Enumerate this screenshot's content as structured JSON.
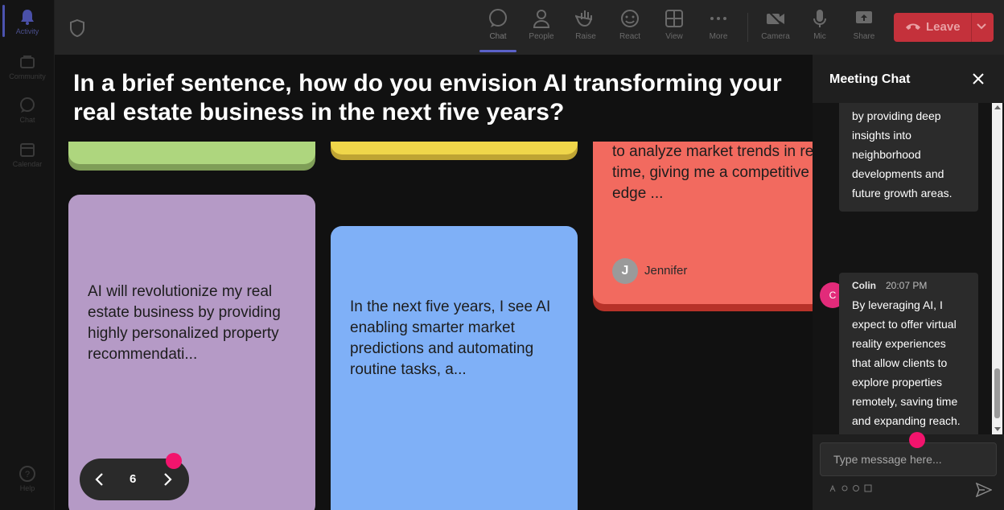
{
  "leftbar": {
    "items": [
      {
        "label": "Activity",
        "icon": "bell-icon"
      },
      {
        "label": "Community",
        "icon": "community-icon"
      },
      {
        "label": "Chat",
        "icon": "chat-icon"
      },
      {
        "label": "Calendar",
        "icon": "calendar-icon"
      },
      {
        "label": "Help",
        "icon": "help-icon"
      }
    ]
  },
  "toolbar": {
    "chat": "Chat",
    "people": "People",
    "raise": "Raise",
    "react": "React",
    "view": "View",
    "more": "More",
    "camera": "Camera",
    "mic": "Mic",
    "share": "Share",
    "leave": "Leave"
  },
  "stage": {
    "question": "In a brief sentence, how do you envision AI transforming your real estate business in the next five years?",
    "cards": [
      {
        "text": "AI will revolutionize my real estate business by providing highly personalized property recommendati...",
        "color": "#b59ac6"
      },
      {
        "text": "In the next five years, I see AI enabling smarter market predictions and automating routine tasks, a...",
        "color": "#7fb0f7"
      },
      {
        "text": "to analyze market trends in real-time, giving me a competitive edge ...",
        "color": "#f26a5f",
        "author_initial": "J",
        "author": "Jennifer"
      }
    ],
    "top_cards": [
      {
        "color": "#aed67e"
      },
      {
        "color": "#f0d64a"
      }
    ],
    "pager": {
      "page": "6"
    }
  },
  "chat": {
    "title": "Meeting Chat",
    "messages": [
      {
        "text": "by providing deep insights into neighborhood developments and future growth areas."
      },
      {
        "name": "Colin",
        "initial": "C",
        "time": "20:07 PM",
        "text": "By leveraging AI, I expect to offer virtual reality experiences that allow clients to explore properties remotely, saving time and expanding reach."
      }
    ],
    "input_placeholder": "Type message here..."
  },
  "colors": {
    "accent": "#5b62c9",
    "leave": "#c4313b",
    "marker": "#f2146d"
  }
}
